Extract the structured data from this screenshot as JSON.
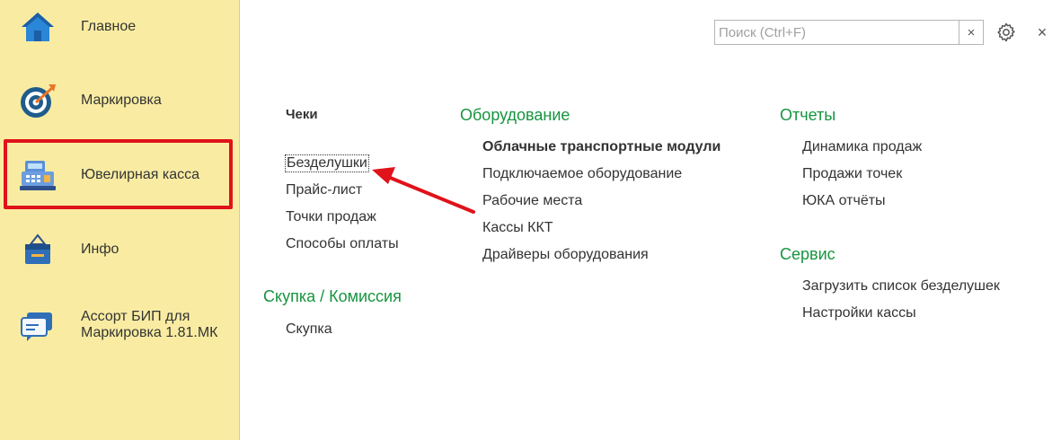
{
  "sidebar": {
    "items": [
      {
        "label": "Главное",
        "icon": "home-icon"
      },
      {
        "label": "Маркировка",
        "icon": "target-icon"
      },
      {
        "label": "Ювелирная касса",
        "icon": "cash-register-icon"
      },
      {
        "label": "Инфо",
        "icon": "info-bag-icon"
      },
      {
        "label": "Ассорт БИП для\nМаркировка 1.81.МК",
        "icon": "chat-icon"
      }
    ]
  },
  "toolbar": {
    "search_placeholder": "Поиск (Ctrl+F)",
    "search_value": "",
    "clear_label": "×",
    "close_label": "×"
  },
  "content": {
    "checks": {
      "title": "Чеки",
      "items": [
        "Безделушки",
        "Прайс-лист",
        "Точки продаж",
        "Способы оплаты"
      ]
    },
    "purchase": {
      "title": "Скупка / Комиссия",
      "items": [
        "Скупка"
      ]
    },
    "equipment": {
      "title": "Оборудование",
      "items": [
        "Облачные транспортные модули",
        "Подключаемое оборудование",
        "Рабочие места",
        "Кассы ККТ",
        "Драйверы оборудования"
      ]
    },
    "reports": {
      "title": "Отчеты",
      "items": [
        "Динамика продаж",
        "Продажи точек",
        "ЮКА отчёты"
      ]
    },
    "service": {
      "title": "Сервис",
      "items": [
        "Загрузить список безделушек",
        "Настройки кассы"
      ]
    }
  },
  "colors": {
    "sidebar_bg": "#f9eca2",
    "section_green": "#16953f",
    "highlight_red": "#e0121a"
  }
}
